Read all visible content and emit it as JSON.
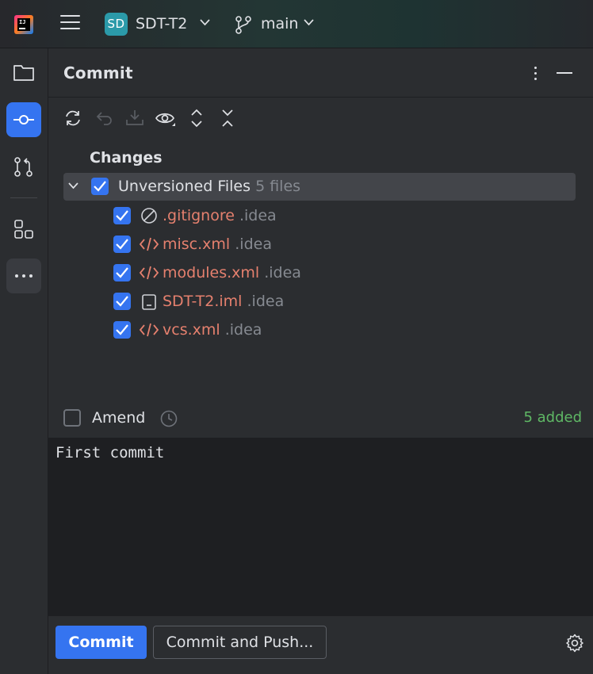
{
  "titlebar": {
    "project_badge": "SD",
    "project_name": "SDT-T2",
    "branch_name": "main"
  },
  "panel": {
    "title": "Commit",
    "changes_label": "Changes",
    "group": {
      "label": "Unversioned Files",
      "count": "5 files"
    },
    "files": [
      {
        "name": ".gitignore",
        "dir": ".idea",
        "icon": "ignore-file-icon"
      },
      {
        "name": "misc.xml",
        "dir": ".idea",
        "icon": "xml-file-icon"
      },
      {
        "name": "modules.xml",
        "dir": ".idea",
        "icon": "xml-file-icon"
      },
      {
        "name": "SDT-T2.iml",
        "dir": ".idea",
        "icon": "module-file-icon"
      },
      {
        "name": "vcs.xml",
        "dir": ".idea",
        "icon": "xml-file-icon"
      }
    ],
    "amend_label": "Amend",
    "added_status": "5 added",
    "commit_message": "First commit",
    "commit_button": "Commit",
    "commit_push_button": "Commit and Push..."
  },
  "colors": {
    "accent": "#3574f0",
    "file_unversioned": "#e5806e",
    "added_green": "#5fb865",
    "project_badge": "#2b9aa9"
  }
}
